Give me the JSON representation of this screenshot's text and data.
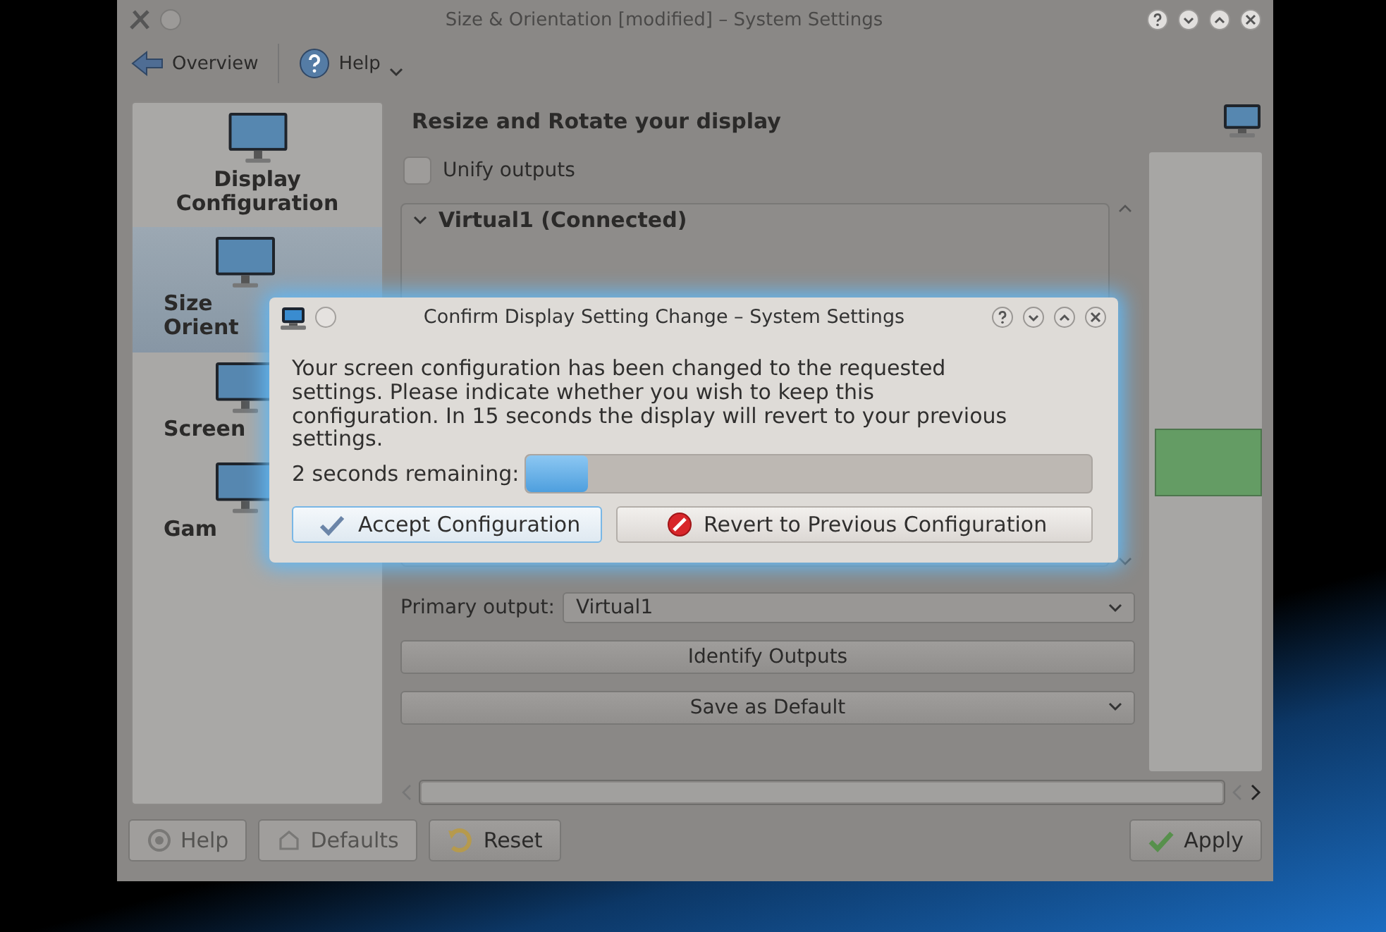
{
  "window": {
    "title": "Size & Orientation [modified] – System Settings"
  },
  "toolbar": [
    {
      "kind": "back",
      "label": "Overview",
      "has_menu": false
    },
    {
      "kind": "help",
      "label": "Help",
      "has_menu": true
    }
  ],
  "sidebar": {
    "items": [
      {
        "label_lines": [
          "Display",
          "Configuration"
        ],
        "selected": false
      },
      {
        "label_lines": [
          "Size",
          "Orient"
        ],
        "selected": true
      },
      {
        "label_lines": [
          "Screen"
        ],
        "selected": false
      },
      {
        "label_lines": [
          "Gam"
        ],
        "selected": false
      }
    ]
  },
  "page": {
    "heading": "Resize and Rotate your display"
  },
  "unify": {
    "label": "Unify outputs",
    "checked": false
  },
  "output_group": {
    "title": "Virtual1 (Connected)",
    "expanded": true
  },
  "primary_output": {
    "label": "Primary output:",
    "value": "Virtual1"
  },
  "actions": [
    {
      "label": "Identify Outputs",
      "has_menu": false
    },
    {
      "label": "Save as Default",
      "has_menu": true
    }
  ],
  "bottom_buttons": [
    {
      "kind": "help",
      "label": "Help",
      "disabled": true
    },
    {
      "kind": "defaults",
      "label": "Defaults",
      "disabled": true
    },
    {
      "kind": "reset",
      "label": "Reset",
      "disabled": false
    },
    {
      "kind": "apply",
      "label": "Apply",
      "disabled": false
    }
  ],
  "dialog": {
    "title": "Confirm Display Setting Change – System Settings",
    "message": "Your screen configuration has been changed to the requested settings. Please indicate whether you wish to keep this configuration. In 15 seconds the display will revert to your previous settings.",
    "countdown": {
      "label": "2 seconds remaining:",
      "level": 0.11
    },
    "buttons": [
      {
        "kind": "accept",
        "label": "Accept Configuration",
        "default": true
      },
      {
        "kind": "revert",
        "label": "Revert to Previous Configuration",
        "default": false
      }
    ]
  }
}
